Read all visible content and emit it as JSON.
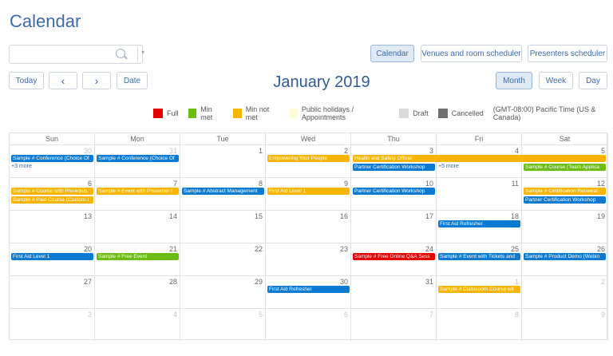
{
  "app": {
    "title": "Calendar"
  },
  "search": {
    "placeholder": ""
  },
  "view_tabs": {
    "calendar": "Calendar",
    "venues": "Venues and room scheduler",
    "presenters": "Presenters scheduler"
  },
  "nav": {
    "today": "Today",
    "prev": "‹",
    "next": "›",
    "date": "Date"
  },
  "period": {
    "title": "January 2019"
  },
  "range_tabs": {
    "month": "Month",
    "week": "Week",
    "day": "Day"
  },
  "legend": [
    {
      "label": "Full",
      "color": "#e20000"
    },
    {
      "label": "Min met",
      "color": "#6cbc12"
    },
    {
      "label": "Min not met",
      "color": "#f7b500"
    },
    {
      "label": "Public holidays / Appointments",
      "color": "#fffbd6"
    },
    {
      "label": "Draft",
      "color": "#d9d9d9"
    },
    {
      "label": "Cancelled",
      "color": "#707070"
    }
  ],
  "timezone": "(GMT-08:00) Pacific Time (US & Canada)",
  "days_of_week": [
    "Sun",
    "Mon",
    "Tue",
    "Wed",
    "Thu",
    "Fri",
    "Sat"
  ],
  "weeks": [
    [
      {
        "d": "30",
        "other": true
      },
      {
        "d": "31",
        "other": true
      },
      {
        "d": "1"
      },
      {
        "d": "2"
      },
      {
        "d": "3"
      },
      {
        "d": "4"
      },
      {
        "d": "5"
      }
    ],
    [
      {
        "d": "6"
      },
      {
        "d": "7"
      },
      {
        "d": "8"
      },
      {
        "d": "9"
      },
      {
        "d": "10"
      },
      {
        "d": "11"
      },
      {
        "d": "12"
      }
    ],
    [
      {
        "d": "13"
      },
      {
        "d": "14"
      },
      {
        "d": "15"
      },
      {
        "d": "16"
      },
      {
        "d": "17"
      },
      {
        "d": "18"
      },
      {
        "d": "19"
      }
    ],
    [
      {
        "d": "20"
      },
      {
        "d": "21"
      },
      {
        "d": "22"
      },
      {
        "d": "23"
      },
      {
        "d": "24"
      },
      {
        "d": "25"
      },
      {
        "d": "26"
      }
    ],
    [
      {
        "d": "27"
      },
      {
        "d": "28"
      },
      {
        "d": "29"
      },
      {
        "d": "30"
      },
      {
        "d": "31"
      },
      {
        "d": "1",
        "other": true
      },
      {
        "d": "2",
        "other": true
      }
    ],
    [
      {
        "d": "3",
        "other": true
      },
      {
        "d": "4",
        "other": true
      },
      {
        "d": "5",
        "other": true
      },
      {
        "d": "6",
        "other": true
      },
      {
        "d": "7",
        "other": true
      },
      {
        "d": "8",
        "other": true
      },
      {
        "d": "9",
        "other": true
      }
    ]
  ],
  "events": [
    {
      "text": "Sample # Conference (Choice Of",
      "week": 0,
      "col": 0,
      "span": 1,
      "row": 0,
      "color": "blue"
    },
    {
      "text": "Sample # Conference (Choice Of",
      "week": 0,
      "col": 1,
      "span": 1,
      "row": 0,
      "color": "blue"
    },
    {
      "text": "Empowering Your People",
      "week": 0,
      "col": 3,
      "span": 1,
      "row": 0,
      "color": "orange"
    },
    {
      "text": "Health and Safety Officer",
      "week": 0,
      "col": 4,
      "span": 3,
      "row": 0,
      "color": "orange"
    },
    {
      "text": "Partner Certification Workshop",
      "week": 0,
      "col": 4,
      "span": 1,
      "row": 1,
      "color": "blue"
    },
    {
      "text": "Sample # Course (Team Applica",
      "week": 0,
      "col": 6,
      "span": 1,
      "row": 1,
      "color": "green"
    },
    {
      "text": "Sample # Course with Prerequis",
      "week": 1,
      "col": 0,
      "span": 1,
      "row": 0,
      "color": "orange"
    },
    {
      "text": "Sample # Event with Presenter I",
      "week": 1,
      "col": 1,
      "span": 1,
      "row": 0,
      "color": "orange"
    },
    {
      "text": "Sample # Abstract Management",
      "week": 1,
      "col": 2,
      "span": 1,
      "row": 0,
      "color": "blue"
    },
    {
      "text": "First Aid Level 1",
      "week": 1,
      "col": 3,
      "span": 1,
      "row": 0,
      "color": "orange"
    },
    {
      "text": "Partner Certification Workshop",
      "week": 1,
      "col": 4,
      "span": 1,
      "row": 0,
      "color": "blue"
    },
    {
      "text": "Sample # Certification Renewal",
      "week": 1,
      "col": 6,
      "span": 1,
      "row": 0,
      "color": "orange"
    },
    {
      "text": "Sample # Paid Course (Custom I",
      "week": 1,
      "col": 0,
      "span": 1,
      "row": 1,
      "color": "orange"
    },
    {
      "text": "Partner Certification Workshop",
      "week": 1,
      "col": 6,
      "span": 1,
      "row": 1,
      "color": "blue"
    },
    {
      "text": "First Aid Refresher",
      "week": 2,
      "col": 5,
      "span": 1,
      "row": 0,
      "color": "blue"
    },
    {
      "text": "First Aid Level 1",
      "week": 3,
      "col": 0,
      "span": 1,
      "row": 0,
      "color": "blue"
    },
    {
      "text": "Sample # Free Event",
      "week": 3,
      "col": 1,
      "span": 1,
      "row": 0,
      "color": "green"
    },
    {
      "text": "Sample # Free Online Q&A Sess",
      "week": 3,
      "col": 4,
      "span": 1,
      "row": 0,
      "color": "red"
    },
    {
      "text": "Sample # Event with Tickets and",
      "week": 3,
      "col": 5,
      "span": 1,
      "row": 0,
      "color": "blue"
    },
    {
      "text": "Sample # Product Demo (Webin",
      "week": 3,
      "col": 6,
      "span": 1,
      "row": 0,
      "color": "blue"
    },
    {
      "text": "First Aid Refresher",
      "week": 4,
      "col": 3,
      "span": 1,
      "row": 0,
      "color": "blue"
    },
    {
      "text": "Sample # Classroom Course wit",
      "week": 4,
      "col": 5,
      "span": 1,
      "row": 0,
      "color": "orange"
    }
  ],
  "more_links": [
    {
      "text": "+3 more",
      "week": 0,
      "col": 0,
      "row": 1
    },
    {
      "text": "+5 more",
      "week": 0,
      "col": 5,
      "row": 1
    }
  ]
}
